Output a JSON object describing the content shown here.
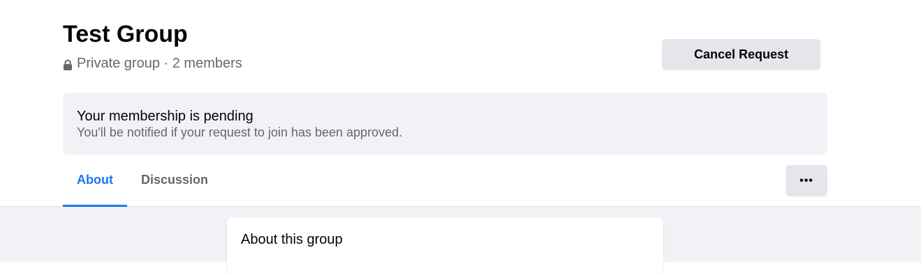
{
  "group": {
    "title": "Test Group",
    "meta": "Private group · 2 members"
  },
  "actions": {
    "cancel_request_label": "Cancel Request",
    "more_label": "•••"
  },
  "pending": {
    "title": "Your membership is pending",
    "subtitle": "You'll be notified if your request to join has been approved."
  },
  "tabs": [
    {
      "label": "About",
      "active": true
    },
    {
      "label": "Discussion",
      "active": false
    }
  ],
  "about_card": {
    "title": "About this group"
  },
  "colors": {
    "accent": "#1877f2",
    "button_bg": "#e4e6eb",
    "panel_bg": "#f0f2f5",
    "secondary_text": "#65676b"
  },
  "icons": {
    "privacy": "lock-icon",
    "more": "more-horizontal-icon"
  }
}
